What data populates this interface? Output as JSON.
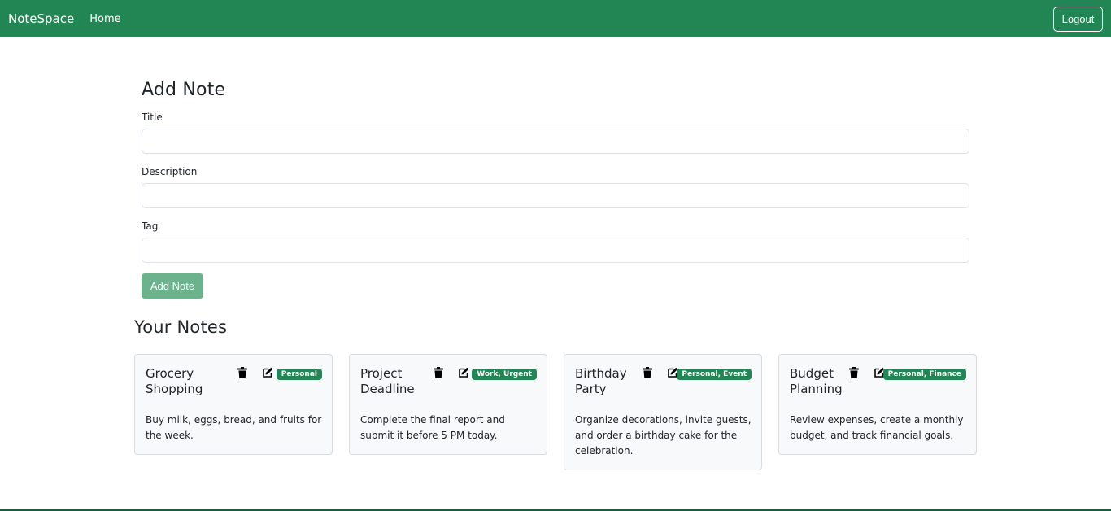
{
  "colors": {
    "navbar": "#218654",
    "badge": "#218654",
    "add_button": "#6bb28d",
    "card_bg": "#f8f9fa"
  },
  "navbar": {
    "brand": "NoteSpace",
    "home": "Home",
    "logout": "Logout"
  },
  "form": {
    "heading": "Add Note",
    "title_label": "Title",
    "title_value": "",
    "description_label": "Description",
    "description_value": "",
    "tag_label": "Tag",
    "tag_value": "",
    "submit_label": "Add Note"
  },
  "notes_heading": "Your Notes",
  "notes": [
    {
      "title": "Grocery Shopping",
      "tag": "Personal",
      "description": "Buy milk, eggs, bread, and fruits for the week.",
      "icons": [
        "trash-icon",
        "edit-icon"
      ]
    },
    {
      "title": "Project Deadline",
      "tag": "Work, Urgent",
      "description": "Complete the final report and submit it before 5 PM today.",
      "icons": [
        "trash-icon",
        "edit-icon"
      ]
    },
    {
      "title": "Birthday Party",
      "tag": "Personal, Event",
      "description": "Organize decorations, invite guests, and order a birthday cake for the celebration.",
      "icons": [
        "trash-icon",
        "edit-icon"
      ]
    },
    {
      "title": "Budget Planning",
      "tag": "Personal, Finance",
      "description": "Review expenses, create a monthly budget, and track financial goals.",
      "icons": [
        "trash-icon",
        "edit-icon"
      ]
    }
  ]
}
